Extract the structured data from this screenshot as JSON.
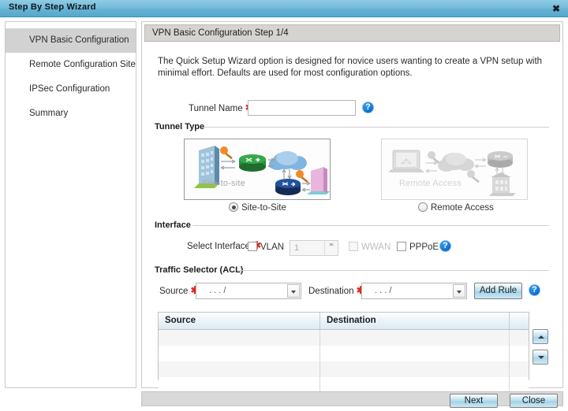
{
  "window": {
    "title": "Step By Step Wizard",
    "close_glyph": "✖"
  },
  "sidebar": {
    "items": [
      {
        "label": "VPN Basic Configuration",
        "active": true
      },
      {
        "label": "Remote Configuration Site",
        "active": false
      },
      {
        "label": "IPSec Configuration",
        "active": false
      },
      {
        "label": "Summary",
        "active": false
      }
    ]
  },
  "panel": {
    "header": "VPN Basic Configuration  Step 1/4",
    "description": "The Quick Setup Wizard option is designed for novice users wanting to create a VPN setup with minimal effort. Defaults are used for most configuration options."
  },
  "tunnel_name": {
    "label": "Tunnel Name",
    "required_mark": "✱",
    "value": "",
    "placeholder": "",
    "help_glyph": "?"
  },
  "tunnel_type": {
    "group_label": "Tunnel Type",
    "options": [
      {
        "id": "site-to-site",
        "label": "Site-to-Site",
        "image_caption": "Site-to-site",
        "selected": true,
        "enabled": true
      },
      {
        "id": "remote-access",
        "label": "Remote Access",
        "image_caption": "Remote Access",
        "selected": false,
        "enabled": false
      }
    ]
  },
  "interface": {
    "group_label": "Interface",
    "select_label": "Select Interface",
    "required_mark": "✱",
    "checkboxes": [
      {
        "id": "vlan",
        "label": "VLAN",
        "checked": false,
        "enabled": true
      },
      {
        "id": "wwan",
        "label": "WWAN",
        "checked": false,
        "enabled": false
      },
      {
        "id": "pppoe",
        "label": "PPPoE",
        "checked": false,
        "enabled": true
      }
    ],
    "vlan_spinner": {
      "value": "1",
      "enabled": false
    },
    "help_glyph": "?"
  },
  "traffic_selector": {
    "group_label": "Traffic Selector (ACL)",
    "source_label": "Source",
    "destination_label": "Destination",
    "required_mark": "✱",
    "source_value": ".    .    .      /",
    "destination_value": ".    .    .      /",
    "add_rule_label": "Add Rule",
    "help_glyph": "?"
  },
  "rules_table": {
    "columns": [
      "Source",
      "Destination",
      ""
    ],
    "rows": [
      [
        "",
        "",
        ""
      ],
      [
        "",
        "",
        ""
      ],
      [
        "",
        "",
        ""
      ],
      [
        "",
        "",
        ""
      ]
    ],
    "sort_up_name": "move-up",
    "sort_down_name": "move-down"
  },
  "footer": {
    "next_label": "Next",
    "close_label": "Close"
  },
  "colors": {
    "titlebar": "#74bcdb",
    "accent_help": "#0b6fd0",
    "required": "#e02b1d",
    "nav_active": "#d2d2d2",
    "panel_header": "#d6d4d0"
  }
}
